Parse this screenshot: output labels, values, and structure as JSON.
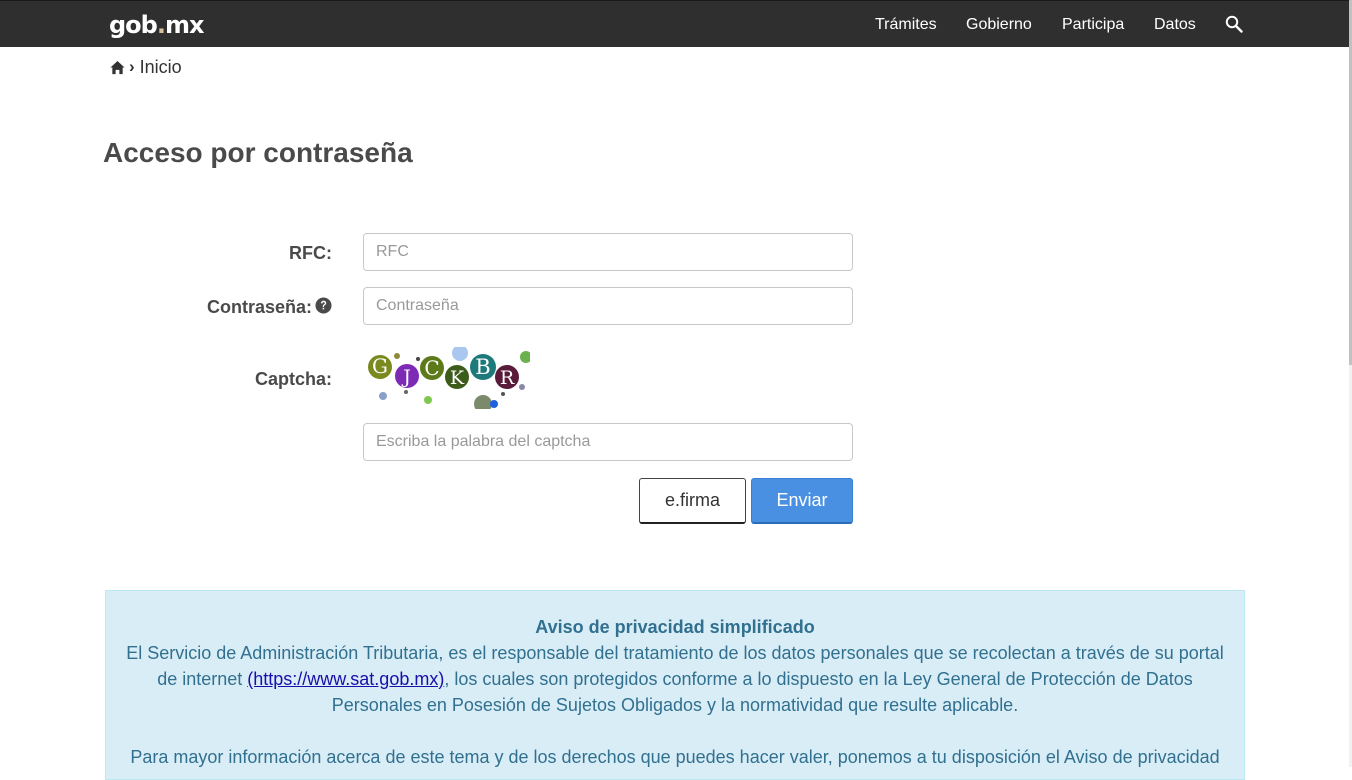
{
  "header": {
    "logo_main": "gob",
    "logo_dot": ".",
    "logo_suffix": "mx",
    "nav": [
      "Trámites",
      "Gobierno",
      "Participa",
      "Datos"
    ],
    "search_icon": "search-icon"
  },
  "breadcrumb": {
    "separator": "›",
    "current": "Inicio",
    "home_icon": "home-icon"
  },
  "page": {
    "title": "Acceso por contraseña"
  },
  "form": {
    "rfc_label": "RFC:",
    "rfc_placeholder": "RFC",
    "password_label": "Contraseña:",
    "password_placeholder": "Contraseña",
    "help_icon": "question-circle-icon",
    "captcha_label": "Captcha:",
    "captcha_text": [
      "G",
      "J",
      "C",
      "K",
      "B",
      "R"
    ],
    "captcha_placeholder": "Escriba la palabra del captcha",
    "efirma_button": "e.firma",
    "submit_button": "Enviar"
  },
  "notice": {
    "title": "Aviso de privacidad simplificado",
    "body_before_link": "El Servicio de Administración Tributaria, es el responsable del tratamiento de los datos personales que se recolectan a través de su portal de internet ",
    "link_text": "(https://www.sat.gob.mx)",
    "body_after_link": ", los cuales son protegidos conforme a lo dispuesto en la Ley General de Protección de Datos Personales en Posesión de Sujetos Obligados y la normatividad que resulte aplicable.",
    "more_info": "Para mayor información acerca de este tema y de los derechos que puedes hacer valer, ponemos a tu disposición el Aviso de privacidad"
  },
  "colors": {
    "topbar": "#2f2f2f",
    "primary_button": "#4a90e2",
    "notice_bg": "#d9edf7",
    "notice_text": "#31708f"
  }
}
